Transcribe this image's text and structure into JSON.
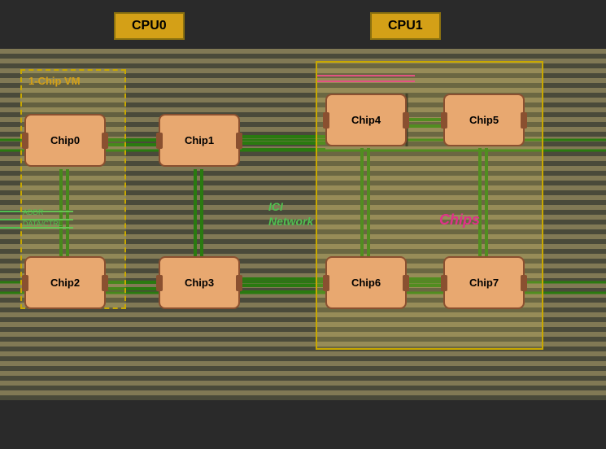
{
  "cpu_labels": {
    "cpu0": "CPU0",
    "cpu1": "CPU1"
  },
  "vm_label": "1-Chip VM",
  "chips": [
    {
      "id": "chip0",
      "label": "Chip0"
    },
    {
      "id": "chip1",
      "label": "Chip1"
    },
    {
      "id": "chip2",
      "label": "Chip2"
    },
    {
      "id": "chip3",
      "label": "Chip3"
    },
    {
      "id": "chip4",
      "label": "Chip4"
    },
    {
      "id": "chip5",
      "label": "Chip5"
    },
    {
      "id": "chip6",
      "label": "Chip6"
    },
    {
      "id": "chip7",
      "label": "Chip7"
    }
  ],
  "ici_label": "ICI\nNetwork",
  "chips_text": "Chips",
  "colors": {
    "chip_bg": "#e8a870",
    "chip_border": "#8a5030",
    "cpu_bg": "#d4a017",
    "vm_border": "#c8a800",
    "line_green": "#2a7a10",
    "ici_green": "#50c050",
    "chips_pink": "#e0308a"
  }
}
